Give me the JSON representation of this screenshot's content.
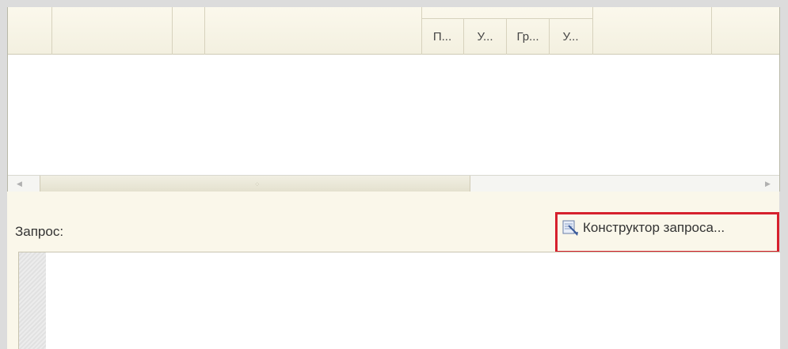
{
  "grid": {
    "subheaders": [
      "П...",
      "У...",
      "Гр...",
      "У..."
    ]
  },
  "query": {
    "label": "Запрос:",
    "constructor_label": "Конструктор запроса..."
  },
  "icons": {
    "constructor": "query-constructor-icon",
    "scroll_left": "arrow-left-icon",
    "scroll_right": "arrow-right-icon"
  },
  "colors": {
    "panel": "#faf7ea",
    "highlight": "#d6202d"
  }
}
